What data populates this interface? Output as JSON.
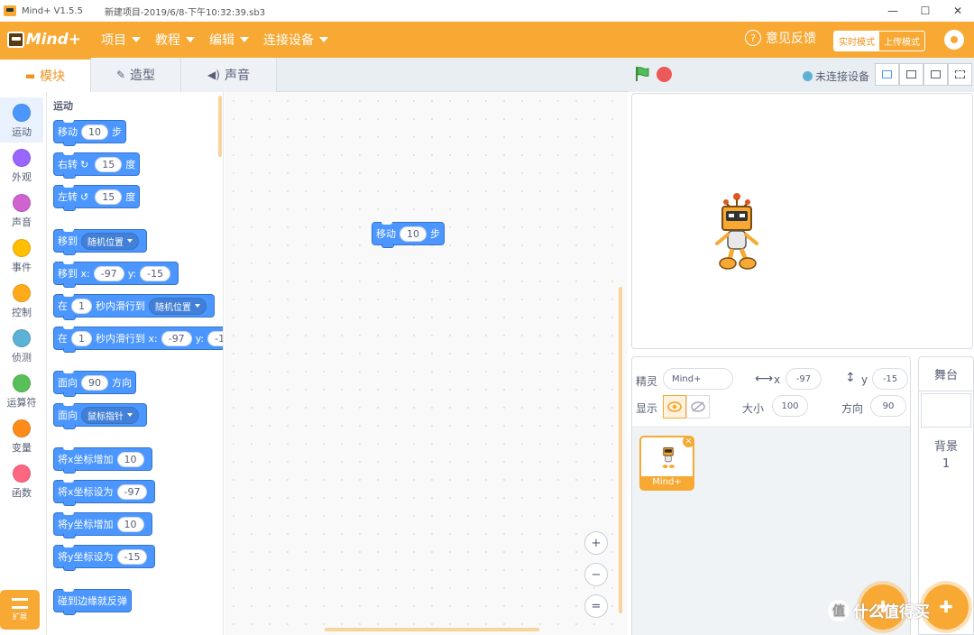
{
  "titlebar": {
    "app": "Mind+ V1.5.5",
    "file": "新建项目-2019/6/8-下午10:32:39.sb3",
    "minimize": "—",
    "maximize": "☐",
    "close": "✕"
  },
  "menu": {
    "logo": "Mind+",
    "items": [
      "项目",
      "教程",
      "编辑",
      "连接设备"
    ],
    "feedback": "意见反馈",
    "mode_realtime": "实时模式",
    "mode_upload": "上传模式"
  },
  "tabs": [
    "模块",
    "造型",
    "声音"
  ],
  "categories": [
    {
      "label": "运动",
      "color": "#4c97ff"
    },
    {
      "label": "外观",
      "color": "#9966ff"
    },
    {
      "label": "声音",
      "color": "#cf63cf"
    },
    {
      "label": "事件",
      "color": "#ffbf00"
    },
    {
      "label": "控制",
      "color": "#ffab19"
    },
    {
      "label": "侦测",
      "color": "#5cb1d6"
    },
    {
      "label": "运算符",
      "color": "#59c059"
    },
    {
      "label": "变量",
      "color": "#ff8c1a"
    },
    {
      "label": "函数",
      "color": "#ff6680"
    }
  ],
  "extension_label": "扩展",
  "palette": {
    "title": "运动",
    "move": {
      "a": "移动",
      "v": "10",
      "b": "步"
    },
    "turn_right": {
      "a": "右转",
      "icon": "↻",
      "v": "15",
      "b": "度"
    },
    "turn_left": {
      "a": "左转",
      "icon": "↺",
      "v": "15",
      "b": "度"
    },
    "goto": {
      "a": "移到",
      "d": "随机位置"
    },
    "goto_xy": {
      "a": "移到 x:",
      "x": "-97",
      "b": "y:",
      "y": "-15"
    },
    "glide": {
      "a": "在",
      "v": "1",
      "b": "秒内滑行到",
      "d": "随机位置"
    },
    "glide_xy": {
      "a": "在",
      "v": "1",
      "b": "秒内滑行到 x:",
      "x": "-97",
      "c": "y:",
      "y": "-1"
    },
    "point_dir": {
      "a": "面向",
      "v": "90",
      "b": "方向"
    },
    "point_to": {
      "a": "面向",
      "d": "鼠标指针"
    },
    "change_x": {
      "a": "将x坐标增加",
      "v": "10"
    },
    "set_x": {
      "a": "将x坐标设为",
      "v": "-97"
    },
    "change_y": {
      "a": "将y坐标增加",
      "v": "10"
    },
    "set_y": {
      "a": "将y坐标设为",
      "v": "-15"
    },
    "bounce": "碰到边缘就反弹"
  },
  "script_block": {
    "a": "移动",
    "v": "10",
    "b": "步"
  },
  "zoom": {
    "in": "+",
    "out": "−",
    "reset": "="
  },
  "stage_header": {
    "connection": "未连接设备"
  },
  "sprite_info": {
    "sprite_label": "精灵",
    "sprite_name": "Mind+",
    "x_label": "x",
    "x_value": "-97",
    "y_label": "y",
    "y_value": "-15",
    "show_label": "显示",
    "size_label": "大小",
    "size_value": "100",
    "direction_label": "方向",
    "direction_value": "90"
  },
  "sprites": [
    {
      "name": "Mind+"
    }
  ],
  "stage_pane": {
    "title": "舞台",
    "backdrop_label": "背景",
    "backdrop_count": "1"
  },
  "watermark": "什么值得买"
}
